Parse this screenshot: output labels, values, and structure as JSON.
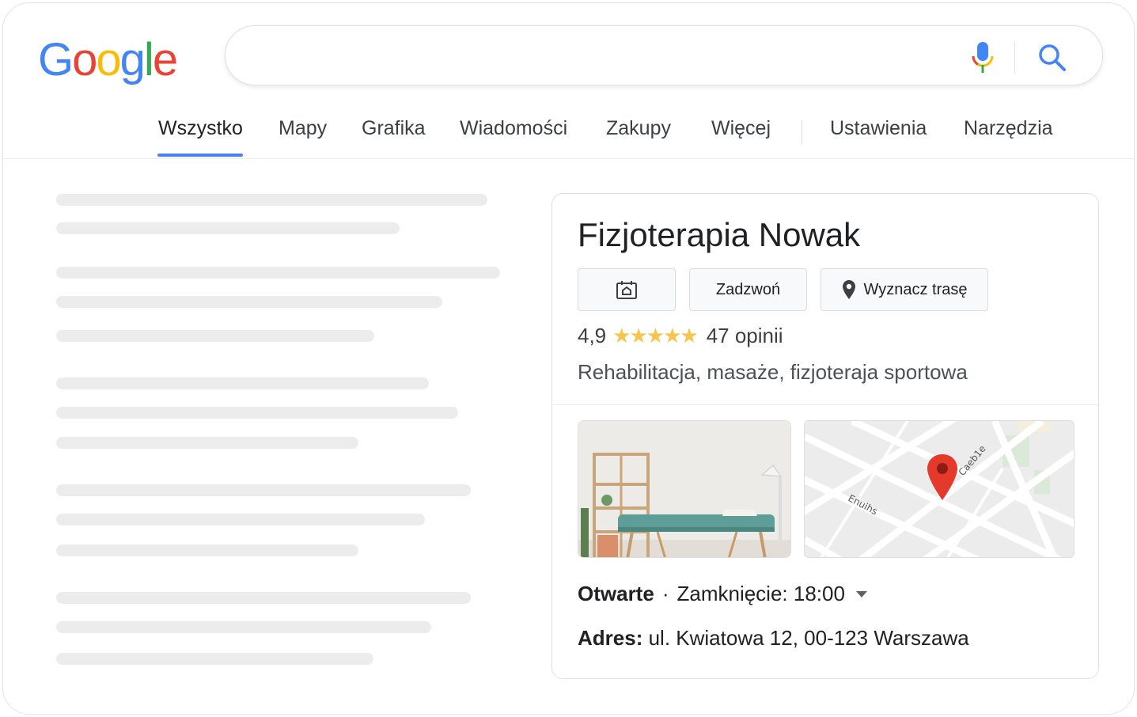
{
  "logo": {
    "letters": [
      "G",
      "o",
      "o",
      "g",
      "l",
      "e"
    ],
    "colors": [
      "#4285f4",
      "#ea4335",
      "#fbbc05",
      "#4285f4",
      "#34a853",
      "#ea4335"
    ]
  },
  "search": {
    "value": "",
    "placeholder": ""
  },
  "icons": {
    "voice": "mic-icon",
    "search": "search-icon",
    "website": "website-icon",
    "directions": "location-pin-icon"
  },
  "tabs": [
    {
      "label": "Wszystko",
      "active": true
    },
    {
      "label": "Mapy"
    },
    {
      "label": "Grafika"
    },
    {
      "label": "Wiadomości"
    },
    {
      "label": "Zakupy"
    },
    {
      "label": "Więcej"
    },
    {
      "label": "Ustawienia"
    },
    {
      "label": "Narzędzia"
    }
  ],
  "panel": {
    "title": "Fizjoterapia Nowak",
    "buttons": {
      "call": "Zadzwoń",
      "directions": "Wyznacz trasę"
    },
    "rating": {
      "value": "4,9",
      "stars": "★★★★★",
      "reviews": "47 opinii"
    },
    "category": "Rehabilitacja, masaże, fizjoteraja sportowa",
    "map_labels": {
      "street_a": "Enuihs",
      "street_b": "Caeb1e"
    },
    "hours": {
      "status": "Otwarte",
      "separator": "·",
      "closing": "Zamknięcie: 18:00"
    },
    "address": {
      "label": "Adres:",
      "value": "ul. Kwiatowa 12, 00-123 Warszawa"
    }
  },
  "colors": {
    "accent": "#4a80f0",
    "star": "#f6c64c",
    "pin": "#e5392b",
    "skeleton": "#ececec"
  }
}
